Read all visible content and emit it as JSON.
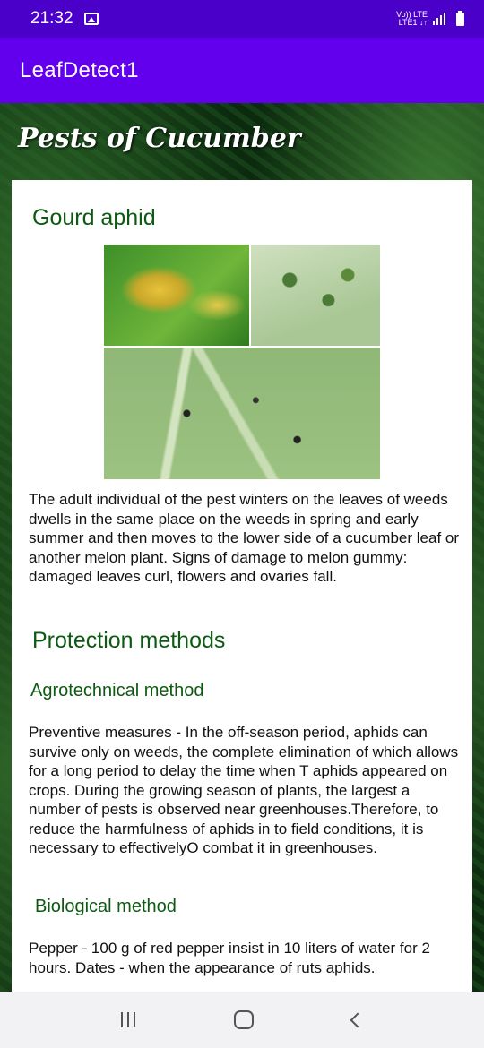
{
  "status_bar": {
    "time": "21:32",
    "network_top": "Vo)) LTE",
    "network_bottom": "LTE1 ↓↑"
  },
  "app_bar": {
    "title": "LeafDetect1"
  },
  "page": {
    "title": "Pests of Cucumber"
  },
  "pest": {
    "name": "Gourd aphid",
    "description": "The adult individual of the pest winters on the leaves of weeds dwells in the same place on the weeds in spring and early summer and then moves to the lower side of a cucumber leaf or another melon plant. Signs of damage to melon gummy: damaged leaves curl, flowers and ovaries fall."
  },
  "protection": {
    "heading": "Protection methods",
    "agrotechnical": {
      "heading": "Agrotechnical method",
      "text": "Preventive measures - In the off-season period, aphids can survive only on weeds, the complete elimination of which allows for a long period to delay the time when T aphids appeared on crops. During the growing season of plants, the largest a number of pests is observed near greenhouses.Therefore, to reduce the harmfulness of aphids in to field conditions, it is necessary to effectivelyO combat it in greenhouses."
    },
    "biological": {
      "heading": "Biological method",
      "text": "Pepper - 100 g of red pepper insist in 10 liters of water for 2 hours. Dates - when the appearance of ruts aphids."
    }
  },
  "nav_bar": {
    "icons": [
      "recent-apps-icon",
      "home-icon",
      "back-icon"
    ]
  },
  "colors": {
    "status_bar": "#4a00c8",
    "app_bar": "#6200ee",
    "heading_green": "#0d5a12"
  }
}
